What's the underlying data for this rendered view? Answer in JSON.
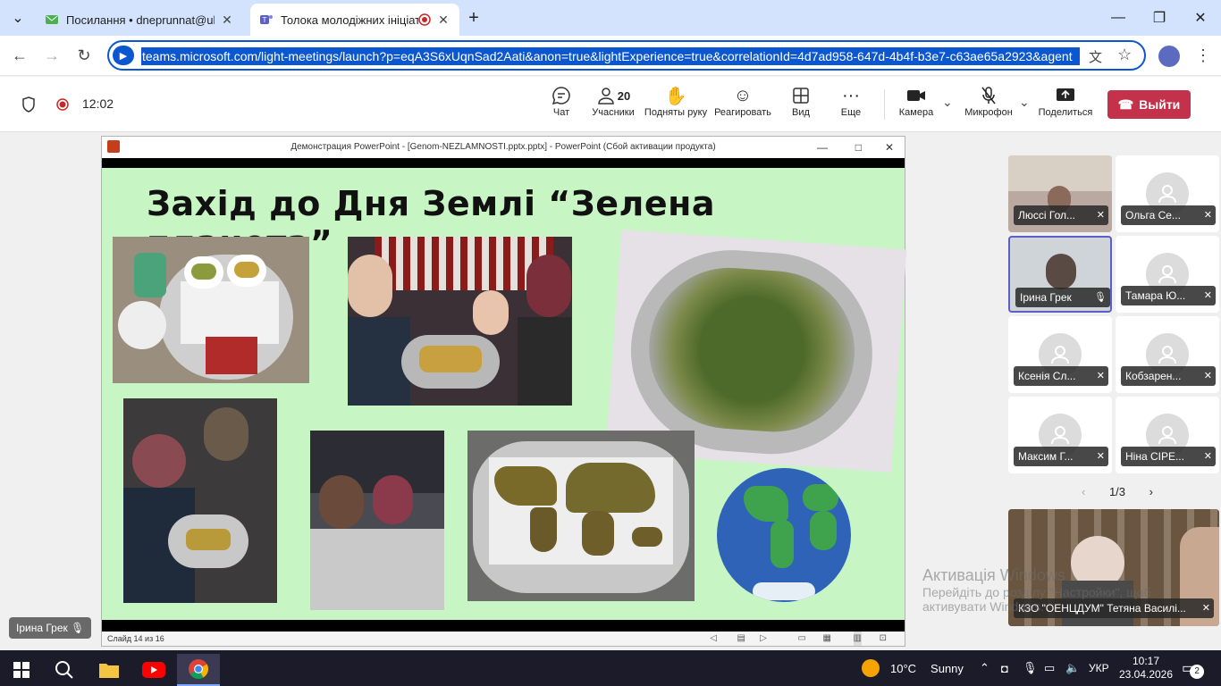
{
  "browser": {
    "tabs": [
      {
        "title": "Посилання • dneprunnat@ukr.",
        "close": "✕"
      },
      {
        "title": "Толока молодіжних ініціати",
        "close": "✕"
      }
    ],
    "new_tab": "+",
    "url": "teams.microsoft.com/light-meetings/launch?p=eqA3S6xUqnSad2Aati&anon=true&lightExperience=true&correlationId=4d7ad958-647d-4b4f-b3e7-c63ae65a2923&agent"
  },
  "meeting": {
    "time": "12:02",
    "chat": "Чат",
    "participants_count": "20",
    "participants": "Учасники",
    "raise_hand": "Подняты руку",
    "react": "Реагировать",
    "view": "Вид",
    "more": "Еще",
    "camera": "Камера",
    "mic": "Микрофон",
    "share": "Поделиться",
    "leave": "Выйти"
  },
  "ppt": {
    "window_title": "Демонстрация PowerPoint - [Genom-NEZLAMNOSTI.pptx.pptx] - PowerPoint (Сбой активации продукта)",
    "slide_title": "Захід до Дня Землі “Зелена планета”",
    "status": "Слайд 14 из 16"
  },
  "speaker_label": "Ірина Грек",
  "participants": [
    {
      "name": "Люссі Гол...",
      "video": true
    },
    {
      "name": "Ольга Се...",
      "video": false
    },
    {
      "name": "Ірина Грек",
      "video": true
    },
    {
      "name": "Тамара Ю...",
      "video": false
    },
    {
      "name": "Ксенія Сл...",
      "video": false
    },
    {
      "name": "Кобзарен...",
      "video": false
    },
    {
      "name": "Максим Г...",
      "video": false
    },
    {
      "name": "Ніна CIPE...",
      "video": false
    }
  ],
  "pager": "1/3",
  "big_tile_name": "КЗО \"ОЕНЦДУМ\" Тетяна Василі...",
  "watermark": {
    "line1": "Активація Windows",
    "line2": "Перейдіть до розділу \"Настройки\", щоб",
    "line3": "активувати Windows."
  },
  "taskbar": {
    "temp": "10°C",
    "weather": "Sunny",
    "lang": "УКР",
    "clock": "10:17",
    "date": "23.04.2026",
    "notif": "2"
  },
  "colors": {
    "accent": "#0b57d0",
    "leave": "#c4314b",
    "slide_bg": "#c7f5c3"
  }
}
